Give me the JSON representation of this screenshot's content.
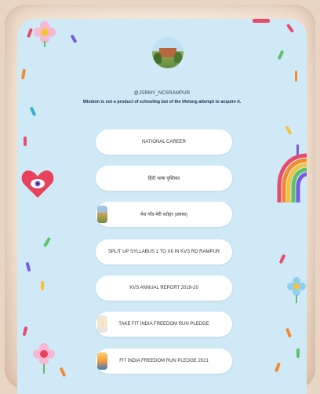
{
  "profile": {
    "handle": "@JSRMY_NCSRAMPUR",
    "bio": "Wisdom is not a product of schooling but of the lifelong attempt to acquire it."
  },
  "links": [
    {
      "label": "NATIONAL CAREER",
      "thumb": ""
    },
    {
      "label": "हिंदी भाषा पुस्तिका",
      "thumb": ""
    },
    {
      "label": "मेरा गाँव मेरी धरोहर (प्रयास)",
      "thumb": "school-photo-thumbnail"
    },
    {
      "label": "SPLIT UP SYLLABUS 1 TO XII IN KVS RD RAMPUR",
      "thumb": ""
    },
    {
      "label": "KVS ANNUAL REPORT 2019-20",
      "thumb": ""
    },
    {
      "label": "TAKE FIT INDIA FREEDOM RUN PLEDGE",
      "thumb": "fit-india-logo-thumbnail"
    },
    {
      "label": "FIT INDIA FREEDOM RUN PLEDGE 2021",
      "thumb": "fit-india-poster-thumbnail"
    }
  ],
  "theme": {
    "background": "#cfeaf6",
    "button": "#ffffff"
  }
}
